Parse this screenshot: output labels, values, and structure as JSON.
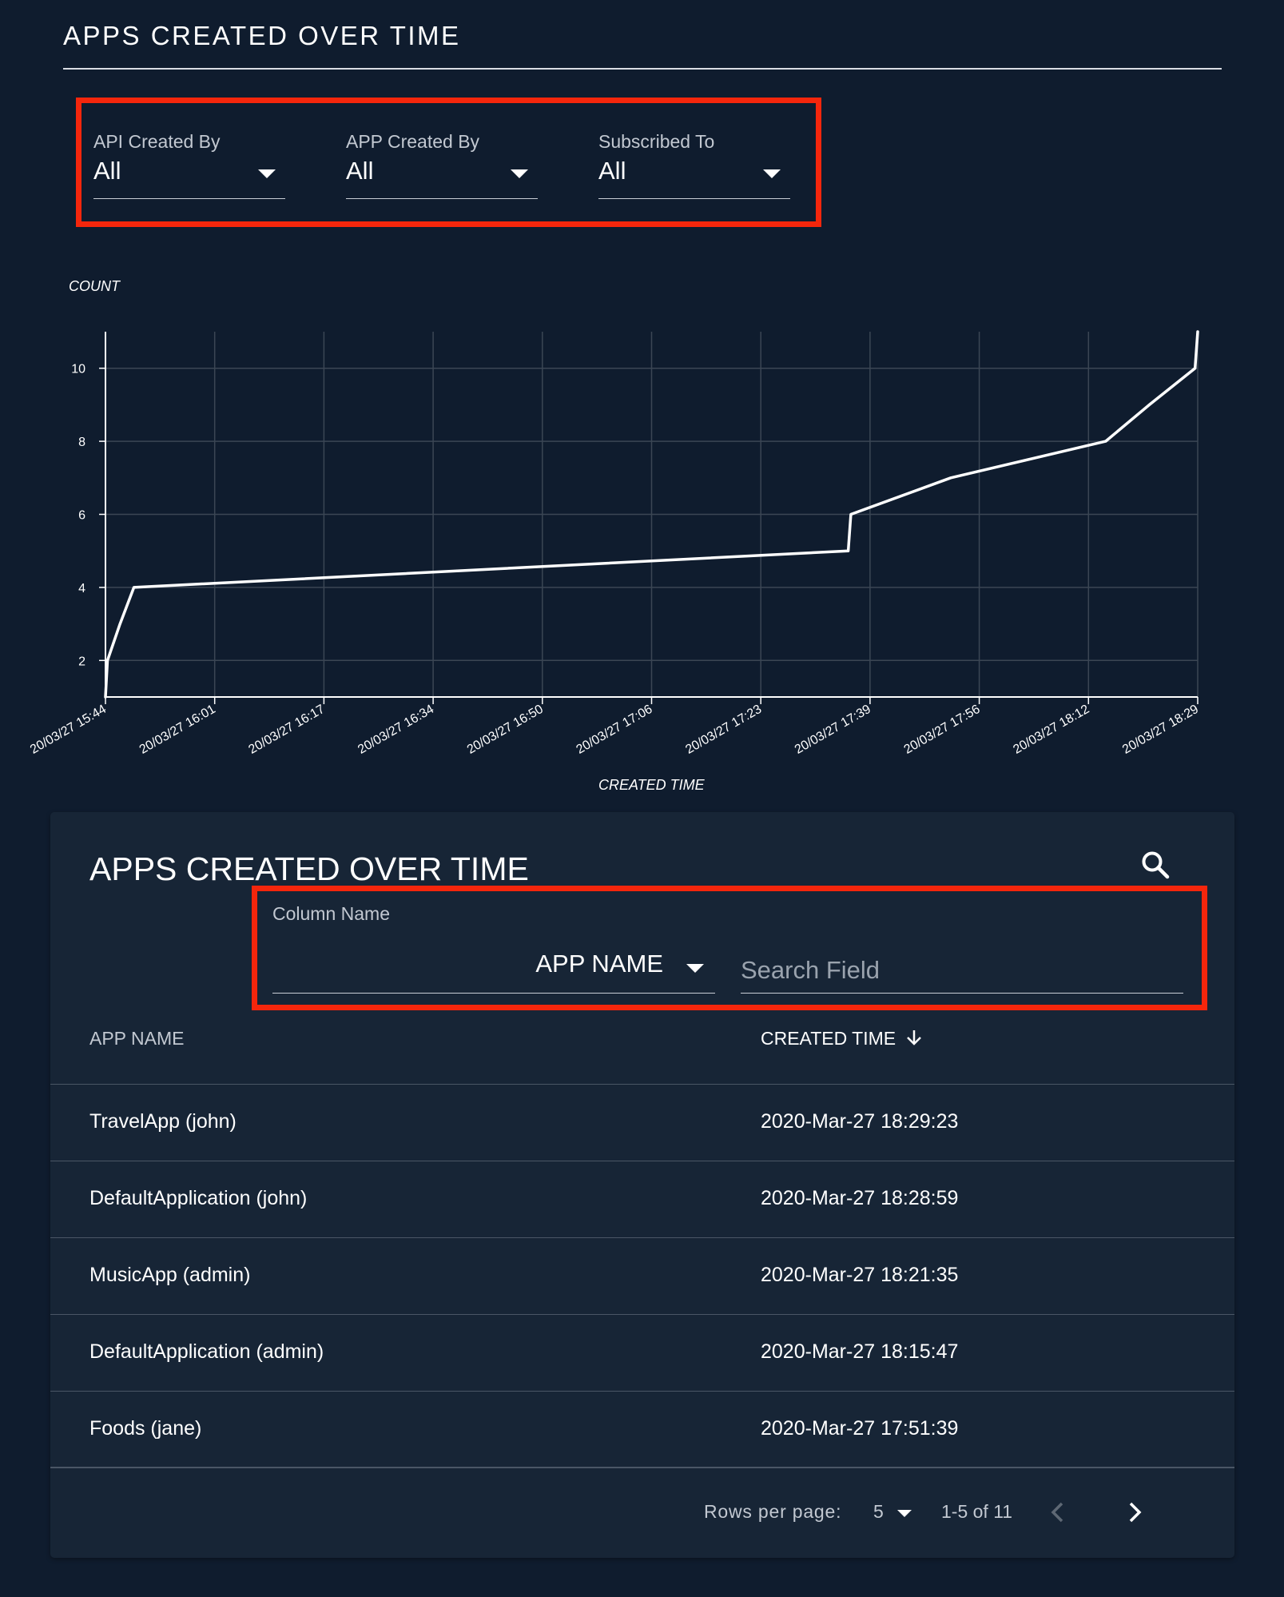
{
  "header": {
    "title": "APPS CREATED OVER TIME"
  },
  "filters": [
    {
      "label": "API Created By",
      "value": "All"
    },
    {
      "label": "APP Created By",
      "value": "All"
    },
    {
      "label": "Subscribed To",
      "value": "All"
    }
  ],
  "chart_data": {
    "type": "line",
    "xlabel": "CREATED TIME",
    "ylabel": "COUNT",
    "ylim": [
      1,
      11
    ],
    "xlim_minutes": [
      0,
      165
    ],
    "y_ticks": [
      2,
      4,
      6,
      8,
      10
    ],
    "x_ticks": [
      {
        "label": "20/03/27 15:44",
        "minutes": 0
      },
      {
        "label": "20/03/27 16:01",
        "minutes": 16.5
      },
      {
        "label": "20/03/27 16:17",
        "minutes": 33
      },
      {
        "label": "20/03/27 16:34",
        "minutes": 49.5
      },
      {
        "label": "20/03/27 16:50",
        "minutes": 66
      },
      {
        "label": "20/03/27 17:06",
        "minutes": 82.5
      },
      {
        "label": "20/03/27 17:23",
        "minutes": 99
      },
      {
        "label": "20/03/27 17:39",
        "minutes": 115.5
      },
      {
        "label": "20/03/27 17:56",
        "minutes": 132
      },
      {
        "label": "20/03/27 18:12",
        "minutes": 148.5
      },
      {
        "label": "20/03/27 18:29",
        "minutes": 165
      }
    ],
    "grid": true,
    "series": [
      {
        "points_minutes_count": [
          [
            0,
            1
          ],
          [
            0.3,
            2
          ],
          [
            2.2,
            3
          ],
          [
            4.3,
            4
          ],
          [
            112.2,
            5
          ],
          [
            112.6,
            6
          ],
          [
            127.7,
            7
          ],
          [
            151.1,
            8
          ],
          [
            157.7,
            9
          ],
          [
            164.6,
            10
          ],
          [
            165,
            11
          ]
        ]
      }
    ]
  },
  "table": {
    "title": "APPS CREATED OVER TIME",
    "search": {
      "column_label": "Column Name",
      "column_value": "APP NAME",
      "placeholder": "Search Field"
    },
    "columns": [
      "APP NAME",
      "CREATED TIME"
    ],
    "rows": [
      {
        "app": "TravelApp (john)",
        "time": "2020-Mar-27 18:29:23"
      },
      {
        "app": "DefaultApplication (john)",
        "time": "2020-Mar-27 18:28:59"
      },
      {
        "app": "MusicApp (admin)",
        "time": "2020-Mar-27 18:21:35"
      },
      {
        "app": "DefaultApplication (admin)",
        "time": "2020-Mar-27 18:15:47"
      },
      {
        "app": "Foods (jane)",
        "time": "2020-Mar-27 17:51:39"
      }
    ],
    "pagination": {
      "rows_per_page_label": "Rows per page:",
      "rows_per_page": "5",
      "range": "1-5 of 11"
    }
  },
  "colors": {
    "background": "#0f1c2e",
    "card": "#172536",
    "highlight": "#f5260c",
    "line": "#ffffff",
    "grid": "#3b4654"
  },
  "icons": [
    "chevron-down-icon",
    "search-icon",
    "arrow-down-icon",
    "chevron-left-icon",
    "chevron-right-icon"
  ]
}
